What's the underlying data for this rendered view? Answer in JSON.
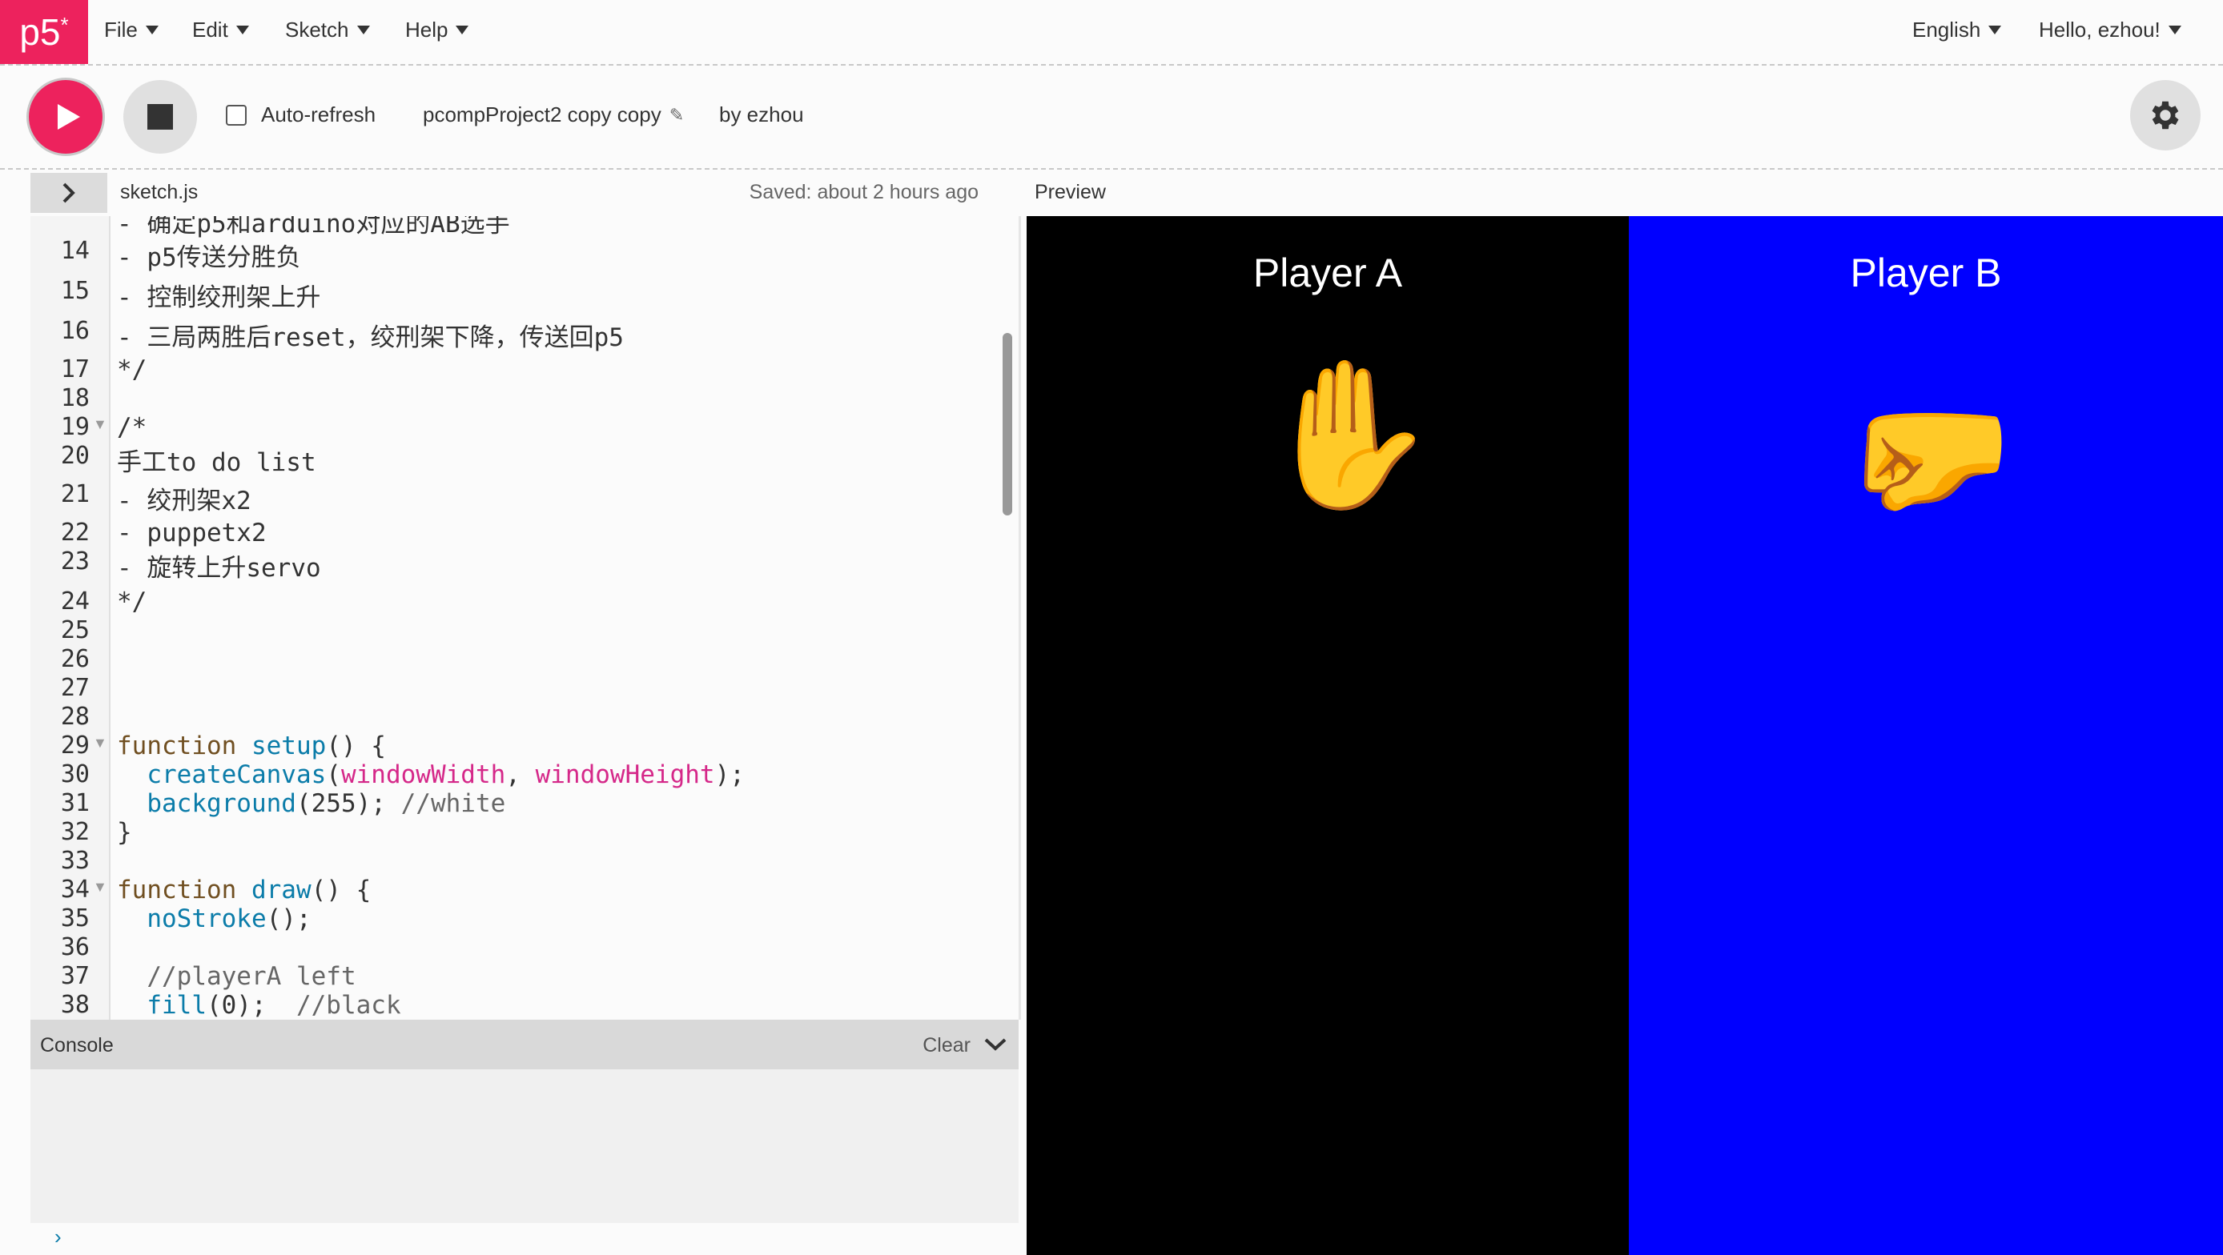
{
  "nav": {
    "logo": "p5",
    "logo_sup": "*",
    "menus": [
      "File",
      "Edit",
      "Sketch",
      "Help"
    ],
    "language": "English",
    "user_greeting": "Hello, ezhou!"
  },
  "toolbar": {
    "auto_refresh_label": "Auto-refresh",
    "project_name": "pcompProject2 copy copy",
    "byline": "by ezhou"
  },
  "editor": {
    "filename": "sketch.js",
    "saved_status": "Saved: about 2 hours ago",
    "partial_top_line": "- 确定p5和arduino对应的AB选手",
    "line_numbers": [
      "14",
      "15",
      "16",
      "17",
      "18",
      "19",
      "20",
      "21",
      "22",
      "23",
      "24",
      "25",
      "26",
      "27",
      "28",
      "29",
      "30",
      "31",
      "32",
      "33",
      "34",
      "35",
      "36",
      "37",
      "38"
    ],
    "lines": {
      "l14": "- p5传送分胜负",
      "l15": "- 控制绞刑架上升",
      "l16": "- 三局两胜后reset，绞刑架下降，传送回p5",
      "l17": "*/",
      "l19": "/*",
      "l20": "手工to do list",
      "l21": "- 绞刑架x2",
      "l22": "- puppetx2",
      "l23": "- 旋转上升servo",
      "l24": "*/",
      "l29_kw": "function",
      "l29_fn": "setup",
      "l29_rest": "() {",
      "l30_fn": "createCanvas",
      "l30_p1": "(",
      "l30_a1": "windowWidth",
      "l30_p2": ", ",
      "l30_a2": "windowHeight",
      "l30_p3": ");",
      "l31_fn": "background",
      "l31_rest": "(255); ",
      "l31_cm": "//white",
      "l32": "}",
      "l34_kw": "function",
      "l34_fn": "draw",
      "l34_rest": "() {",
      "l35_fn": "noStroke",
      "l35_rest": "();",
      "l37_cm": "//playerA left",
      "l38_fn": "fill",
      "l38_rest": "(0);  ",
      "l38_cm": "//black"
    }
  },
  "console": {
    "title": "Console",
    "clear_label": "Clear",
    "prompt": "›"
  },
  "preview": {
    "label": "Preview",
    "player_a": {
      "title": "Player A",
      "emoji": "✋",
      "bg": "#000000"
    },
    "player_b": {
      "title": "Player B",
      "emoji": "🤛",
      "bg": "#0000ff"
    }
  },
  "colors": {
    "accent": "#ed225d",
    "keyword": "#704f21",
    "function": "#0b7ca9",
    "builtin": "#d52889"
  }
}
